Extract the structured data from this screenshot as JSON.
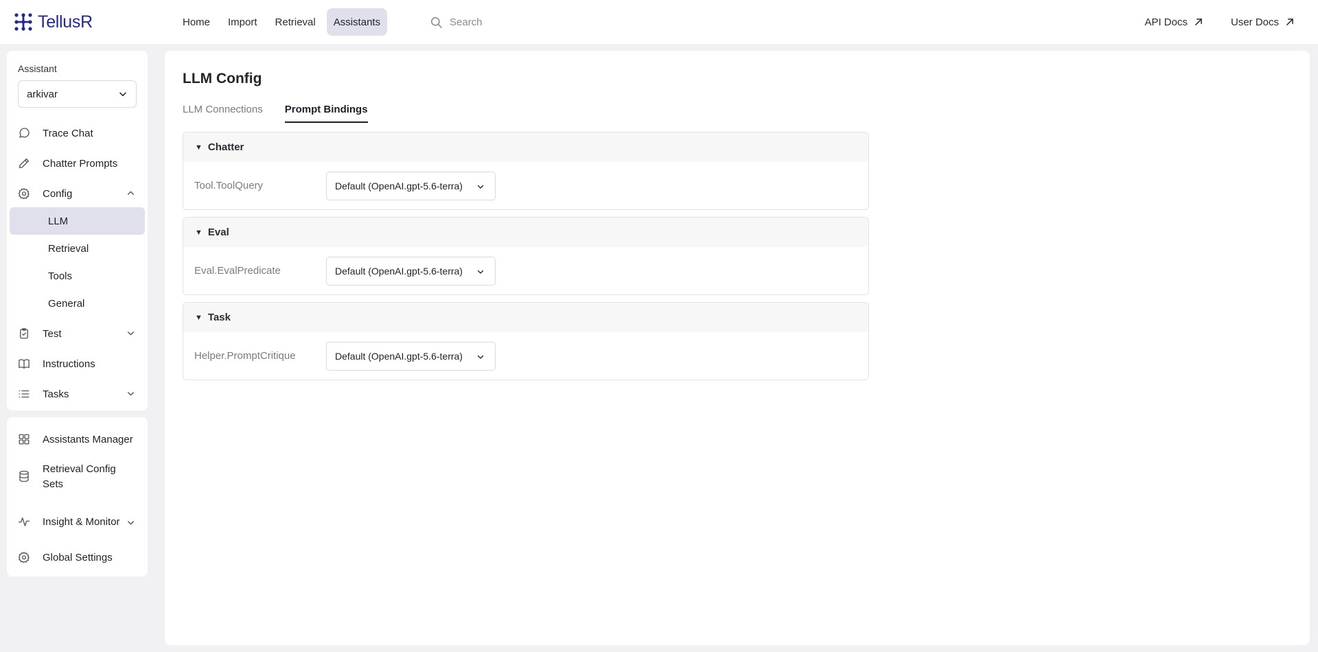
{
  "app": {
    "name": "TellusR"
  },
  "nav": {
    "items": [
      {
        "label": "Home"
      },
      {
        "label": "Import"
      },
      {
        "label": "Retrieval"
      },
      {
        "label": "Assistants"
      }
    ],
    "active": "Assistants",
    "search_placeholder": "Search",
    "api_docs": "API Docs",
    "user_docs": "User Docs"
  },
  "sidebar": {
    "assistant_label": "Assistant",
    "assistant_value": "arkivar",
    "items": {
      "trace_chat": "Trace Chat",
      "chatter_prompts": "Chatter Prompts",
      "config": "Config",
      "config_sub": {
        "llm": "LLM",
        "retrieval": "Retrieval",
        "tools": "Tools",
        "general": "General"
      },
      "test": "Test",
      "instructions": "Instructions",
      "tasks": "Tasks"
    },
    "bottom": {
      "assistants_manager": "Assistants Manager",
      "retrieval_config_sets": "Retrieval Config Sets",
      "insight_monitor": "Insight & Monitor",
      "global_settings": "Global Settings"
    }
  },
  "main": {
    "title": "LLM Config",
    "tabs": [
      {
        "label": "LLM Connections",
        "active": false
      },
      {
        "label": "Prompt Bindings",
        "active": true
      }
    ],
    "groups": [
      {
        "name": "Chatter",
        "rows": [
          {
            "label": "Tool.ToolQuery",
            "value": "Default (OpenAI.gpt-5.6-terra)"
          }
        ]
      },
      {
        "name": "Eval",
        "rows": [
          {
            "label": "Eval.EvalPredicate",
            "value": "Default (OpenAI.gpt-5.6-terra)"
          }
        ]
      },
      {
        "name": "Task",
        "rows": [
          {
            "label": "Helper.PromptCritique",
            "value": "Default (OpenAI.gpt-5.6-terra)"
          }
        ]
      }
    ]
  },
  "colors": {
    "brand": "#232a8a",
    "active_bg": "#dfe0ec",
    "page_bg": "#f1f1f3"
  }
}
